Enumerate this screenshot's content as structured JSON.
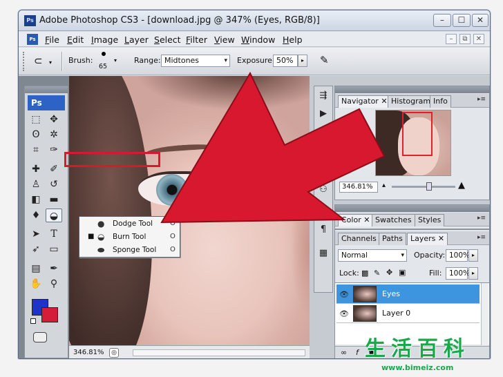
{
  "window": {
    "title": "Adobe Photoshop CS3 - [download.jpg @ 347% (Eyes, RGB/8)]",
    "app_icon": "Ps",
    "controls": {
      "minimize": "–",
      "maximize": "☐",
      "close": "✕"
    }
  },
  "menu": {
    "items": [
      "File",
      "Edit",
      "Image",
      "Layer",
      "Select",
      "Filter",
      "View",
      "Window",
      "Help"
    ],
    "mdi": [
      "–",
      "⧉",
      "✕"
    ]
  },
  "options": {
    "brush_label": "Brush:",
    "brush_size": "65",
    "range_label": "Range:",
    "range_value": "Midtones",
    "exposure_label": "Exposure:",
    "exposure_value": "50%"
  },
  "tools": {
    "logo": "Ps",
    "foreground_color": "#1e34c9",
    "background_color": "#d51d3a"
  },
  "flyout": {
    "items": [
      {
        "label": "Dodge Tool",
        "key": "O",
        "icon": "dodge-icon",
        "selected": false
      },
      {
        "label": "Burn Tool",
        "key": "O",
        "icon": "burn-icon",
        "selected": true
      },
      {
        "label": "Sponge Tool",
        "key": "O",
        "icon": "sponge-icon",
        "selected": false
      }
    ],
    "selected_mark": "■"
  },
  "canvas": {
    "zoom": "346.81%"
  },
  "navigator": {
    "tabs": [
      "Navigator",
      "Histogram",
      "Info"
    ],
    "zoom": "346.81%"
  },
  "color_panel": {
    "tabs": [
      "Color",
      "Swatches",
      "Styles"
    ]
  },
  "layers_panel": {
    "tabs": [
      "Channels",
      "Paths",
      "Layers"
    ],
    "blend_mode": "Normal",
    "opacity_label": "Opacity:",
    "opacity_value": "100%",
    "lock_label": "Lock:",
    "fill_label": "Fill:",
    "fill_value": "100%",
    "layers": [
      {
        "name": "Eyes",
        "selected": true
      },
      {
        "name": "Layer 0",
        "selected": false
      }
    ]
  },
  "annotation": {
    "arrow_color": "#d8182e"
  },
  "watermark": {
    "chars": "生活百科",
    "url": "www.bimeiz.com"
  }
}
